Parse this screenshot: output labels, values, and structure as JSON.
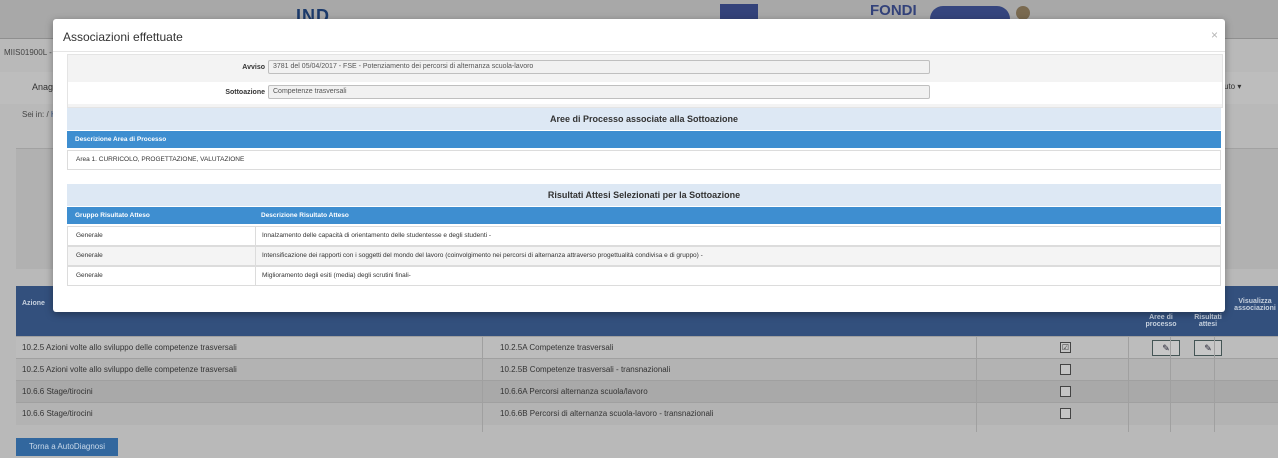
{
  "background": {
    "banner": {
      "logo_ind": "IND",
      "logo_fondi": "FONDI"
    },
    "school_code": "MIIS01900L -",
    "nav": {
      "left_item": "Anagra",
      "right_item": "uto ▾"
    },
    "breadcrumb": {
      "prefix": "Sei in:",
      "link": "Ho"
    },
    "table": {
      "headers": {
        "azione": "Azione",
        "aree": "Aree di processo",
        "risultati": "Risultati attesi",
        "visualizza": "Visualizza associazioni"
      },
      "rows": [
        {
          "azione": "10.2.5 Azioni volte allo sviluppo delle competenze trasversali",
          "sottoazione": "10.2.5A Competenze trasversali",
          "checked": "☑",
          "edit1": "✎",
          "edit2": "✎",
          "eye": "◉"
        },
        {
          "azione": "10.2.5 Azioni volte allo sviluppo delle competenze trasversali",
          "sottoazione": "10.2.5B Competenze trasversali - transnazionali",
          "checked": ""
        },
        {
          "azione": "10.6.6 Stage/tirocini",
          "sottoazione": "10.6.6A Percorsi alternanza scuola/lavoro",
          "checked": ""
        },
        {
          "azione": "10.6.6 Stage/tirocini",
          "sottoazione": "10.6.6B Percorsi di alternanza scuola-lavoro - transnazionali",
          "checked": ""
        }
      ]
    },
    "back_button": "Torna a AutoDiagnosi"
  },
  "modal": {
    "title": "Associazioni effettuate",
    "close": "×",
    "form": {
      "avviso_label": "Avviso",
      "avviso_value": "3781 del 05/04/2017 - FSE - Potenziamento dei percorsi di alternanza scuola-lavoro",
      "sottoazione_label": "Sottoazione",
      "sottoazione_value": "Competenze trasversali"
    },
    "aree": {
      "title": "Aree di Processo associate alla Sottoazione",
      "header": "Descrizione Area di Processo",
      "rows": [
        "Area 1. CURRICOLO, PROGETTAZIONE, VALUTAZIONE"
      ]
    },
    "risultati": {
      "title": "Risultati Attesi Selezionati per la Sottoazione",
      "headers": [
        "Gruppo Risultato Atteso",
        "Descrizione Risultato Atteso"
      ],
      "rows": [
        [
          "Generale",
          "Innalzamento delle capacità di orientamento delle studentesse e degli studenti -"
        ],
        [
          "Generale",
          "Intensificazione dei rapporti con i soggetti del mondo del lavoro (coinvolgimento nei percorsi di alternanza attraverso progettualità condivisa e di gruppo) -"
        ],
        [
          "Generale",
          "Miglioramento degli esiti (media) degli scrutini finali-"
        ]
      ]
    }
  }
}
